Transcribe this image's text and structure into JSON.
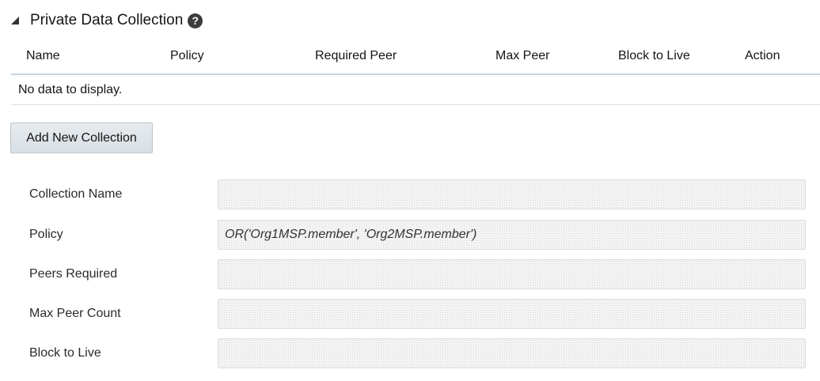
{
  "section": {
    "title": "Private Data Collection",
    "help": "?"
  },
  "table": {
    "columns": [
      "Name",
      "Policy",
      "Required Peer",
      "Max Peer",
      "Block to Live",
      "Action"
    ],
    "empty_message": "No data to display."
  },
  "add_button_label": "Add New Collection",
  "form": {
    "collection_name": {
      "label": "Collection Name",
      "value": ""
    },
    "policy": {
      "label": "Policy",
      "placeholder": "OR('Org1MSP.member', 'Org2MSP.member')"
    },
    "peers_required": {
      "label": "Peers Required",
      "value": ""
    },
    "max_peer_count": {
      "label": "Max Peer Count",
      "value": ""
    },
    "block_to_live": {
      "label": "Block to Live",
      "value": ""
    }
  }
}
